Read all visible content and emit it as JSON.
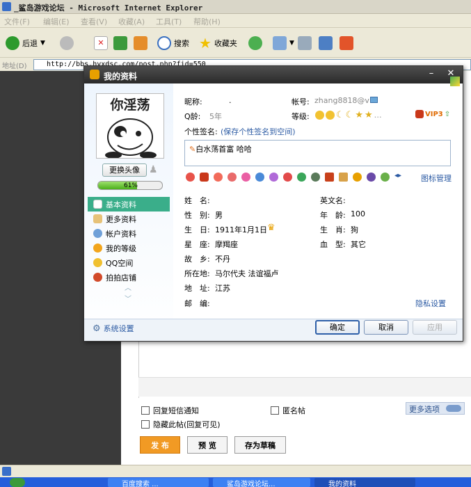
{
  "browser": {
    "title": "_鲨岛游戏论坛 - Microsoft Internet Explorer",
    "menu": [
      "文件(F)",
      "编辑(E)",
      "查看(V)",
      "收藏(A)",
      "工具(T)",
      "帮助(H)"
    ],
    "toolbar": {
      "back": "后退",
      "search": "搜索",
      "favorites": "收藏夹"
    },
    "address_label": "地址(D)",
    "address_value": "http://bbs.hyxdsc.com/post.php?fid=550"
  },
  "dialog": {
    "title": "我的资料",
    "avatar_caption": "你淫荡",
    "change_avatar": "更换头像",
    "progress_text": "61%",
    "progress": 0.61,
    "nav": [
      "基本资料",
      "更多资料",
      "帐户资料",
      "我的等级",
      "QQ空间",
      "拍拍店铺"
    ],
    "system_settings": "系统设置",
    "nickname_label": "昵称:",
    "nickname_value": ".",
    "account_label": "帐号:",
    "account_value": "zhang8818@vi",
    "qage_label": "Q龄:",
    "qage_value": "5年",
    "level_label": "等级:",
    "vip": "VIP3",
    "signature_label": "个性签名:",
    "signature_link": "(保存个性签名到空间)",
    "signature_text": "白水荡首富 哈哈",
    "icon_manage": "图标管理",
    "fields": {
      "name_label": "姓　名:",
      "name_value": "",
      "en_name_label": "英文名:",
      "en_name_value": "",
      "gender_label": "性　别:",
      "gender_value": "男",
      "age_label": "年　龄:",
      "age_value": "100",
      "birthday_label": "生　日:",
      "birthday_value": "1911年1月1日",
      "zodiac_label": "生　肖:",
      "zodiac_value": "狗",
      "constellation_label": "星　座:",
      "constellation_value": "摩羯座",
      "blood_label": "血　型:",
      "blood_value": "其它",
      "hometown_label": "故　乡:",
      "hometown_value": "不丹",
      "location_label": "所在地:",
      "location_value": "马尔代夫 法谊福卢",
      "address_label": "地　址:",
      "address_value": "江苏",
      "zip_label": "邮　编:",
      "zip_value": ""
    },
    "privacy": "隐私设置",
    "ok": "确定",
    "cancel": "取消",
    "apply": "应用"
  },
  "forum": {
    "sms_notify": "回复短信通知",
    "anonymous": "匿名帖",
    "hide_post": "隐藏此帖(回复可见)",
    "more_options": "更多选项",
    "publish": "发 布",
    "preview": "预 览",
    "save_draft": "存为草稿"
  },
  "taskbar": [
    "百度搜索 ...",
    "鲨岛游戏论坛...",
    "我的资料"
  ],
  "colors": {
    "accent_nav": "#3aae8a",
    "publish": "#f19a24",
    "dialog_title": "#2a2a2a"
  }
}
